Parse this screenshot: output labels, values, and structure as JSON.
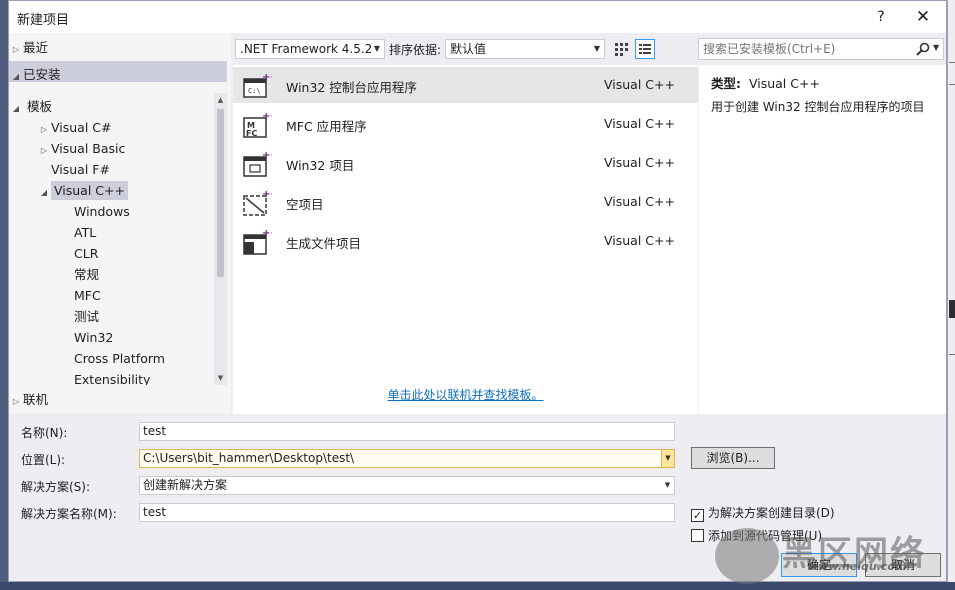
{
  "dialog": {
    "title": "新建项目",
    "help_button": "?",
    "close_button": "✕"
  },
  "nav": {
    "recent": "最近",
    "installed": "已安装",
    "templates": "模板",
    "tree": [
      "Visual C#",
      "Visual Basic",
      "Visual F#",
      "Visual C++",
      "Windows",
      "ATL",
      "CLR",
      "常规",
      "MFC",
      "测试",
      "Win32",
      "Cross Platform",
      "Extensibility"
    ],
    "online": "联机"
  },
  "toolbar": {
    "framework": ".NET Framework 4.5.2",
    "sort_label": "排序依据:",
    "sort_value": "默认值"
  },
  "search": {
    "placeholder": "搜索已安装模板(Ctrl+E)"
  },
  "templates": [
    {
      "name": "Win32 控制台应用程序",
      "lang": "Visual C++"
    },
    {
      "name": "MFC 应用程序",
      "lang": "Visual C++"
    },
    {
      "name": "Win32 项目",
      "lang": "Visual C++"
    },
    {
      "name": "空项目",
      "lang": "Visual C++"
    },
    {
      "name": "生成文件项目",
      "lang": "Visual C++"
    }
  ],
  "online_link": "单击此处以联机并查找模板。",
  "details": {
    "type_label": "类型:",
    "type_value": "Visual C++",
    "description": "用于创建 Win32 控制台应用程序的项目"
  },
  "form": {
    "name_label": "名称(N):",
    "name_value": "test",
    "location_label": "位置(L):",
    "location_value": "C:\\Users\\bit_hammer\\Desktop\\test\\",
    "solution_label": "解决方案(S):",
    "solution_value": "创建新解决方案",
    "solution_name_label": "解决方案名称(M):",
    "solution_name_value": "test",
    "browse_button": "浏览(B)...",
    "create_dir_label": "为解决方案创建目录(D)",
    "add_source_control_label": "添加到源代码管理(U)",
    "ok_button": "确定",
    "cancel_button": "取消"
  },
  "watermark": {
    "text": "黑区网络",
    "url": "www.heiqu.com"
  },
  "colors": {
    "accent": "#3399ff",
    "link": "#0e70c0",
    "selection": "#cccedb"
  }
}
